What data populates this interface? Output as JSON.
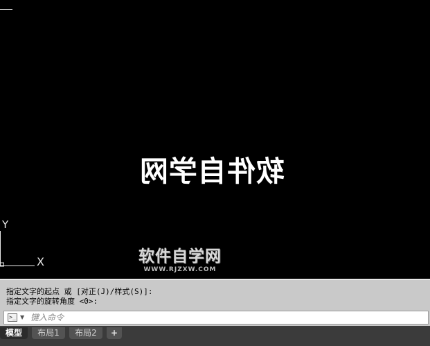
{
  "canvas": {
    "mirrored_text": "软件自学网",
    "ucs": {
      "y_label": "Y",
      "x_label": "X"
    },
    "watermark": {
      "title": "软件自学网",
      "url": "WWW.RJZXW.COM"
    }
  },
  "command": {
    "history": [
      "指定文字的起点 或 [对正(J)/样式(S)]:",
      "指定文字的旋转角度 <0>:"
    ],
    "prompt_icon": "command-prompt-icon",
    "input_value": "",
    "input_placeholder": "键入命令"
  },
  "layout_tabs": {
    "items": [
      {
        "label": "模型",
        "active": true
      },
      {
        "label": "布局1",
        "active": false
      },
      {
        "label": "布局2",
        "active": false
      }
    ],
    "add_label": "+"
  },
  "colors": {
    "canvas_bg": "#000000",
    "command_bg": "#c9c9c9",
    "tab_bar_bg": "#3b3b3b"
  }
}
